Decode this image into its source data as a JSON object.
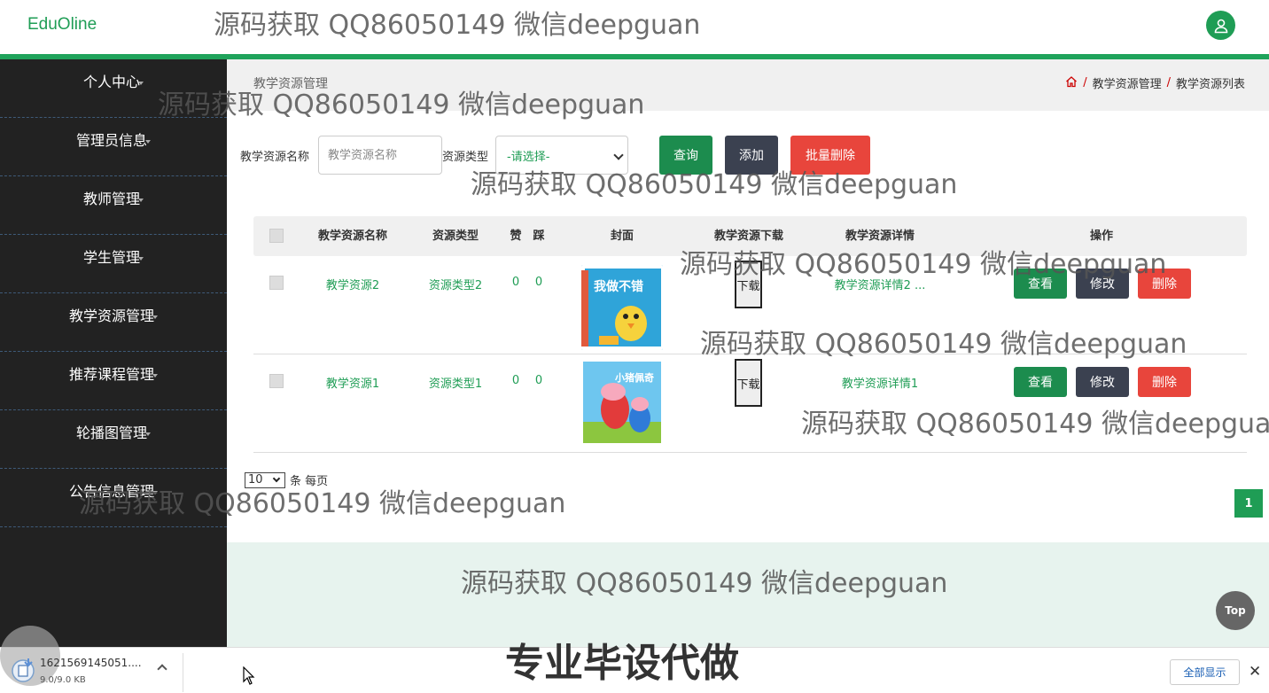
{
  "header": {
    "logo": "EduOline"
  },
  "sidebar": {
    "items": [
      {
        "label": "个人中心"
      },
      {
        "label": "管理员信息"
      },
      {
        "label": "教师管理"
      },
      {
        "label": "学生管理"
      },
      {
        "label": "教学资源管理"
      },
      {
        "label": "推荐课程管理"
      },
      {
        "label": "轮播图管理"
      },
      {
        "label": "公告信息管理"
      }
    ]
  },
  "breadcrumb": {
    "title": "教学资源管理",
    "items": [
      "教学资源管理",
      "教学资源列表"
    ],
    "separator": "/"
  },
  "search": {
    "name_label": "教学资源名称",
    "name_placeholder": "教学资源名称",
    "type_label": "资源类型",
    "type_value": "-请选择-",
    "query_button": "查询",
    "add_button": "添加",
    "batch_delete_button": "批量删除"
  },
  "table": {
    "headers": [
      "教学资源名称",
      "资源类型",
      "赞",
      "踩",
      "封面",
      "教学资源下载",
      "教学资源详情",
      "操作"
    ],
    "rows": [
      {
        "name": "教学资源2",
        "type": "资源类型2",
        "likes": "0",
        "dislikes": "0",
        "cover_text": "我做不错",
        "download": "下载",
        "detail": "教学资源详情2 ...",
        "view": "查看",
        "edit": "修改",
        "delete": "删除"
      },
      {
        "name": "教学资源1",
        "type": "资源类型1",
        "likes": "0",
        "dislikes": "0",
        "cover_text": "小猪佩奇",
        "download": "下载",
        "detail": "教学资源详情1",
        "view": "查看",
        "edit": "修改",
        "delete": "删除"
      }
    ]
  },
  "pagination": {
    "page_size": "10",
    "page_size_suffix": "条 每页",
    "current_page": "1"
  },
  "top_button": "Top",
  "watermarks": {
    "text": "源码获取 QQ86050149 微信deepguan",
    "big": "专业毕设代做"
  },
  "download_bar": {
    "file_name": "1621569145051....",
    "file_size": "9.0/9.0 KB",
    "show_all": "全部显示",
    "close": "✕"
  },
  "colors": {
    "brand": "#1f9d55",
    "sidebar_bg": "#222222",
    "danger": "#e8453c",
    "dark_button": "#3b4150"
  }
}
